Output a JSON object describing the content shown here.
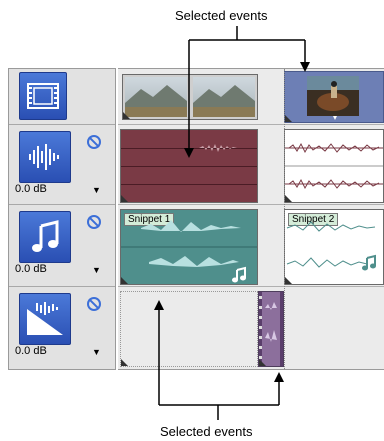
{
  "callouts": {
    "top": "Selected events",
    "bottom": "Selected events"
  },
  "tracks": [
    {
      "type": "video",
      "icon": "film-icon"
    },
    {
      "type": "audio",
      "icon": "waveform-icon",
      "level": "0.0 dB"
    },
    {
      "type": "music",
      "icon": "music-note-icon",
      "level": "0.0 dB"
    },
    {
      "type": "envelope",
      "icon": "envelope-icon",
      "level": "0.0 dB"
    }
  ],
  "events": {
    "snippet1": "Snippet 1",
    "snippet2": "Snippet 2"
  },
  "colors": {
    "audio_event": "#7a3a45",
    "music_event": "#4f8f8c",
    "selected_bg": "#6d7fb5",
    "track_icon": "#2a4fb3"
  }
}
